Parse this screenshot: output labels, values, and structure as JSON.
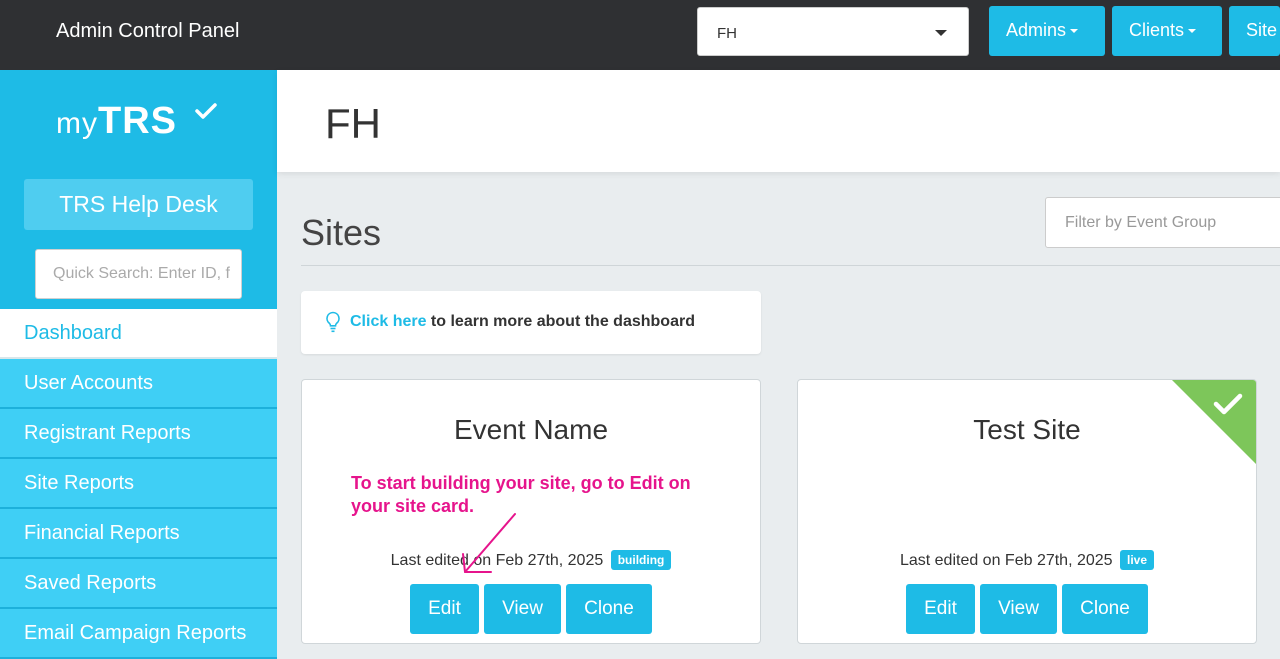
{
  "topbar": {
    "title": "Admin Control Panel",
    "client_select_value": "FH",
    "buttons": {
      "admins": "Admins",
      "clients": "Clients",
      "sites": "Site"
    }
  },
  "sidebar": {
    "logo_my": "my",
    "logo_trs": "TRS",
    "helpdesk": "TRS Help Desk",
    "search_placeholder": "Quick Search: Enter ID, f",
    "nav": [
      "Dashboard",
      "User Accounts",
      "Registrant Reports",
      "Site Reports",
      "Financial Reports",
      "Saved Reports",
      "Email Campaign Reports"
    ]
  },
  "header": {
    "title": "FH"
  },
  "main": {
    "sites_title": "Sites",
    "filter_placeholder": "Filter by Event Group",
    "tip_link": "Click here",
    "tip_rest": " to learn more about the dashboard",
    "cards": [
      {
        "title": "Event Name",
        "edited": "Last edited on Feb 27th, 2025",
        "status": "building",
        "buttons": [
          "Edit",
          "View",
          "Clone"
        ]
      },
      {
        "title": "Test Site",
        "edited": "Last edited on Feb 27th, 2025",
        "status": "live",
        "buttons": [
          "Edit",
          "View",
          "Clone"
        ]
      }
    ]
  },
  "annotation": {
    "line1": "To start building your site, go to Edit on",
    "line2": "your site card.",
    "color": "#e6148c"
  },
  "colors": {
    "accent": "#1ebbe6",
    "topbar": "#2f3033",
    "live_corner": "#7dc65a"
  }
}
